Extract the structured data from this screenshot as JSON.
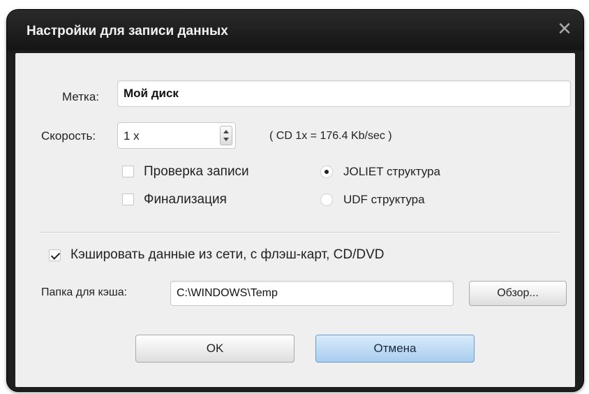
{
  "dialog": {
    "title": "Настройки для записи данных",
    "close_glyph": "✕"
  },
  "label_field": {
    "label": "Метка:",
    "value": "Мой диск"
  },
  "speed": {
    "label": "Скорость:",
    "value": "1 x",
    "hint": "( CD 1x = 176.4 Kb/sec )"
  },
  "options": {
    "verify_label": "Проверка записи",
    "verify_checked": false,
    "finalize_label": "Финализация",
    "finalize_checked": false
  },
  "filesystem": {
    "joliet_label": "JOLIET структура",
    "udf_label": "UDF структура",
    "selected": "joliet"
  },
  "cache": {
    "checkbox_label": "Кэшировать данные из сети, с флэш-карт, CD/DVD",
    "checked": true,
    "folder_label": "Папка для кэша:",
    "folder_value": "C:\\WINDOWS\\Temp",
    "browse_label": "Обзор..."
  },
  "buttons": {
    "ok_label": "OK",
    "cancel_label": "Отмена"
  }
}
